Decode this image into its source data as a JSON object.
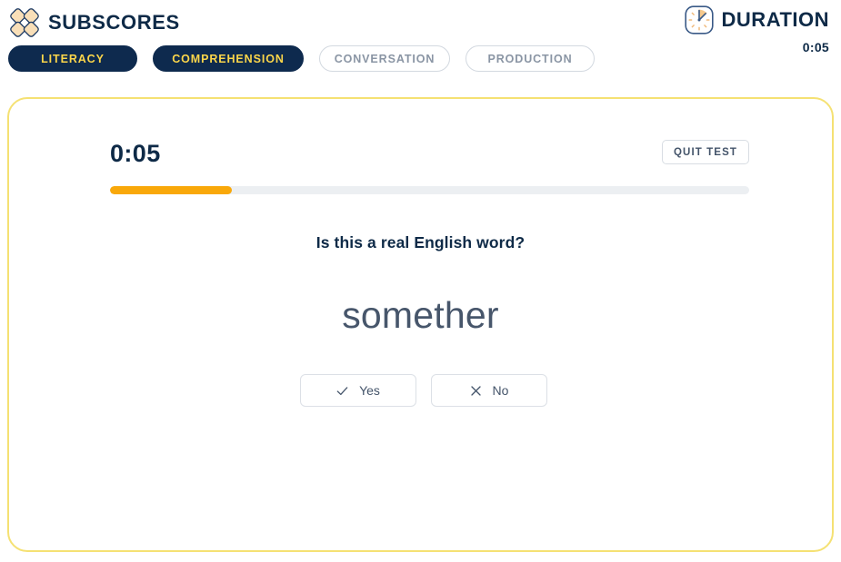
{
  "header": {
    "brand_title": "SUBSCORES",
    "logo_icon": "diamond-cluster-logo",
    "duration_label": "DURATION",
    "duration_icon": "stopwatch-icon",
    "duration_value": "0:05"
  },
  "tabs": [
    {
      "label": "LITERACY",
      "state": "active"
    },
    {
      "label": "COMPREHENSION",
      "state": "active"
    },
    {
      "label": "CONVERSATION",
      "state": "inactive"
    },
    {
      "label": "PRODUCTION",
      "state": "inactive"
    }
  ],
  "card": {
    "timer": "0:05",
    "quit_label": "QUIT TEST",
    "progress_percent": 19,
    "question": "Is this a real English word?",
    "stimulus_word": "somether",
    "answers": [
      {
        "label": "Yes",
        "icon": "check-icon"
      },
      {
        "label": "No",
        "icon": "close-icon"
      }
    ]
  },
  "colors": {
    "navy": "#0e2a4e",
    "accent_yellow": "#fcd64a",
    "card_border": "#f5e173",
    "progress_fill": "#f9a80a",
    "progress_track": "#eceff2",
    "muted_text": "#8a95a4",
    "slate_text": "#44546a"
  }
}
